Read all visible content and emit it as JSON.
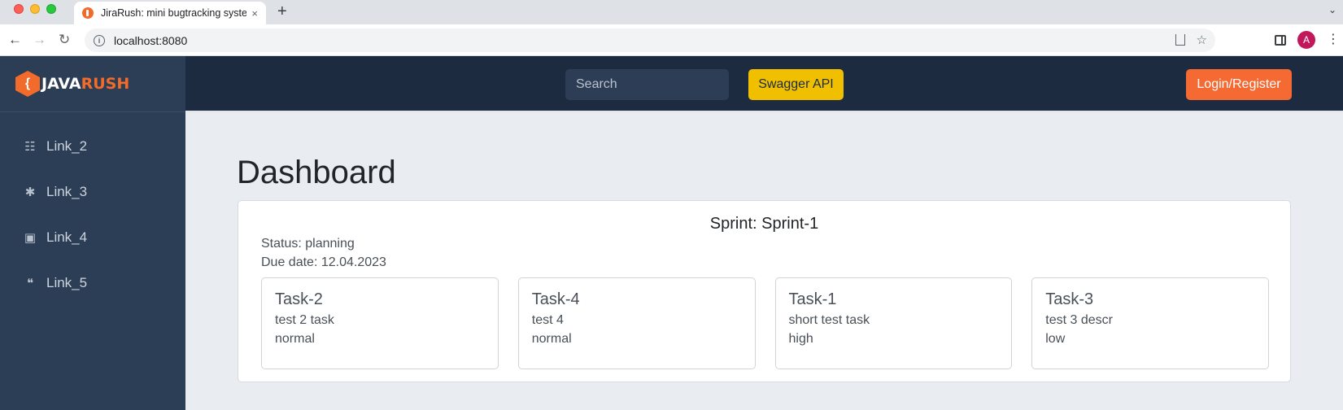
{
  "browser": {
    "tab_title": "JiraRush: mini bugtracking system",
    "tab_close": "×",
    "new_tab": "+",
    "url": "localhost:8080",
    "profile_initial": "A"
  },
  "brand": {
    "logo_glyph": "{",
    "logo_java": "JAVA",
    "logo_rush": "RUSH"
  },
  "sidebar": {
    "items": [
      {
        "label": "Link_2",
        "icon": "list-check-icon",
        "glyph": "☷"
      },
      {
        "label": "Link_3",
        "icon": "bug-icon",
        "glyph": "✱"
      },
      {
        "label": "Link_4",
        "icon": "book-icon",
        "glyph": "▣"
      },
      {
        "label": "Link_5",
        "icon": "comments-icon",
        "glyph": "❝"
      }
    ]
  },
  "header": {
    "search_placeholder": "Search",
    "swagger_label": "Swagger API",
    "login_label": "Login/Register"
  },
  "main": {
    "title": "Dashboard",
    "sprint": {
      "title": "Sprint: Sprint-1",
      "status": "Status: planning",
      "due": "Due date: 12.04.2023",
      "tasks": [
        {
          "key": "Task-2",
          "description": "test 2 task",
          "priority": "normal"
        },
        {
          "key": "Task-4",
          "description": "test 4",
          "priority": "normal"
        },
        {
          "key": "Task-1",
          "description": "short test task",
          "priority": "high"
        },
        {
          "key": "Task-3",
          "description": "test 3 descr",
          "priority": "low"
        }
      ]
    }
  },
  "colors": {
    "sidebar_bg": "#2c3e55",
    "topbar_bg": "#1d2b40",
    "swagger": "#f0c000",
    "login": "#f56a33",
    "brand_orange": "#f26b2a"
  }
}
